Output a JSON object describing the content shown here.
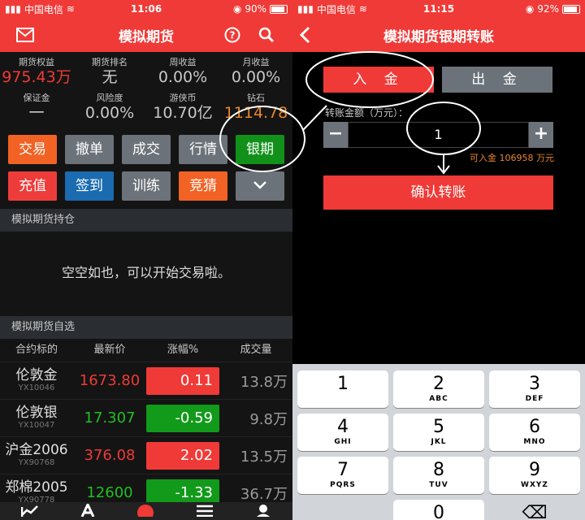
{
  "left": {
    "status": {
      "carrier": "中国电信",
      "time": "11:06",
      "battery": "90%"
    },
    "nav": {
      "title": "模拟期货"
    },
    "stats_row1": [
      {
        "label": "期货权益",
        "value": "975.43万"
      },
      {
        "label": "期货排名",
        "value": "无"
      },
      {
        "label": "周收益",
        "value": "0.00%"
      },
      {
        "label": "月收益",
        "value": "0.00%"
      }
    ],
    "stats_row2": [
      {
        "label": "保证金",
        "value": "一"
      },
      {
        "label": "风险度",
        "value": "0.00%"
      },
      {
        "label": "游侠币",
        "value": "10.70亿"
      },
      {
        "label": "钻石",
        "value": "1114.78"
      }
    ],
    "buttons_row1": [
      "交易",
      "撤单",
      "成交",
      "行情",
      "银期"
    ],
    "buttons_row2": [
      "充值",
      "签到",
      "训练",
      "竞猜"
    ],
    "holdings": {
      "title": "模拟期货持仓",
      "empty_text": "空空如也，可以开始交易啦。"
    },
    "watchlist": {
      "title": "模拟期货自选",
      "headers": [
        "合约标的",
        "最新价",
        "涨幅%",
        "成交量"
      ],
      "rows": [
        {
          "name": "伦敦金",
          "code": "YX10046",
          "price": "1673.80",
          "change": "0.11",
          "volume": "13.8万",
          "dir": "up"
        },
        {
          "name": "伦敦银",
          "code": "YX10047",
          "price": "17.307",
          "change": "-0.59",
          "volume": "9.8万",
          "dir": "down"
        },
        {
          "name": "沪金2006",
          "code": "YX90768",
          "price": "376.08",
          "change": "2.02",
          "volume": "13.5万",
          "dir": "up"
        },
        {
          "name": "郑棉2005",
          "code": "YX90778",
          "price": "12600",
          "change": "-1.33",
          "volume": "36.7万",
          "dir": "down"
        }
      ]
    }
  },
  "right": {
    "status": {
      "carrier": "中国电信",
      "time": "11:15",
      "battery": "92%"
    },
    "nav": {
      "title": "模拟期货银期转账"
    },
    "tabs": [
      "入 金",
      "出 金"
    ],
    "amount_label": "转账金额（万元）：",
    "amount_value": "1",
    "available": "可入金 106958 万元",
    "confirm": "确认转账",
    "keys": [
      {
        "d": "1",
        "l": ""
      },
      {
        "d": "2",
        "l": "ABC"
      },
      {
        "d": "3",
        "l": "DEF"
      },
      {
        "d": "4",
        "l": "GHI"
      },
      {
        "d": "5",
        "l": "JKL"
      },
      {
        "d": "6",
        "l": "MNO"
      },
      {
        "d": "7",
        "l": "PQRS"
      },
      {
        "d": "8",
        "l": "TUV"
      },
      {
        "d": "9",
        "l": "WXYZ"
      },
      {
        "d": "",
        "l": ""
      },
      {
        "d": "0",
        "l": ""
      },
      {
        "d": "⌫",
        "l": ""
      }
    ]
  },
  "colors": {
    "brand_red": "#f03a37",
    "green": "#12911a",
    "orange": "#e8862a"
  }
}
